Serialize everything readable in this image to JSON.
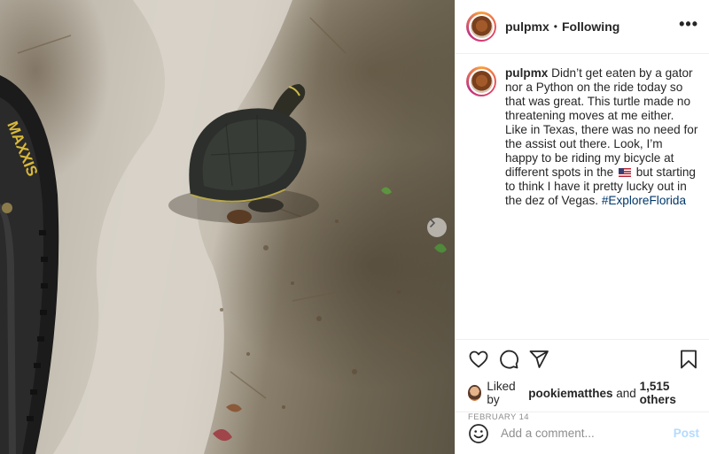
{
  "post": {
    "username": "pulpmx",
    "separator": "•",
    "follow_state": "Following",
    "more_label": "•••",
    "caption": {
      "username": "pulpmx",
      "text_part1": "Didn’t get eaten by a gator nor a Python on the ride today so that was great. This turtle made no threatening moves at me either. Like in Texas, there was no need for the assist out there. Look, I’m happy to be riding my bicycle at different spots in the",
      "flag_icon": "us-flag-icon",
      "text_part2": "but starting to think I have it pretty lucky out in the dez of Vegas.",
      "hashtag": "#ExploreFlorida"
    },
    "likes": {
      "prefix": "Liked by",
      "user": "pookiematthes",
      "connector": "and",
      "count": "1,515 others"
    },
    "date": "FEBRUARY 14",
    "comment": {
      "placeholder": "Add a comment...",
      "post_label": "Post"
    }
  },
  "icons": [
    "heart-icon",
    "comment-icon",
    "share-icon",
    "bookmark-icon",
    "emoji-icon",
    "chevron-right-icon"
  ],
  "colors": {
    "text": "#262626",
    "muted": "#8e8e8e",
    "hashtag": "#00376b",
    "post_disabled": "#b3dbff",
    "border": "#efefef"
  }
}
